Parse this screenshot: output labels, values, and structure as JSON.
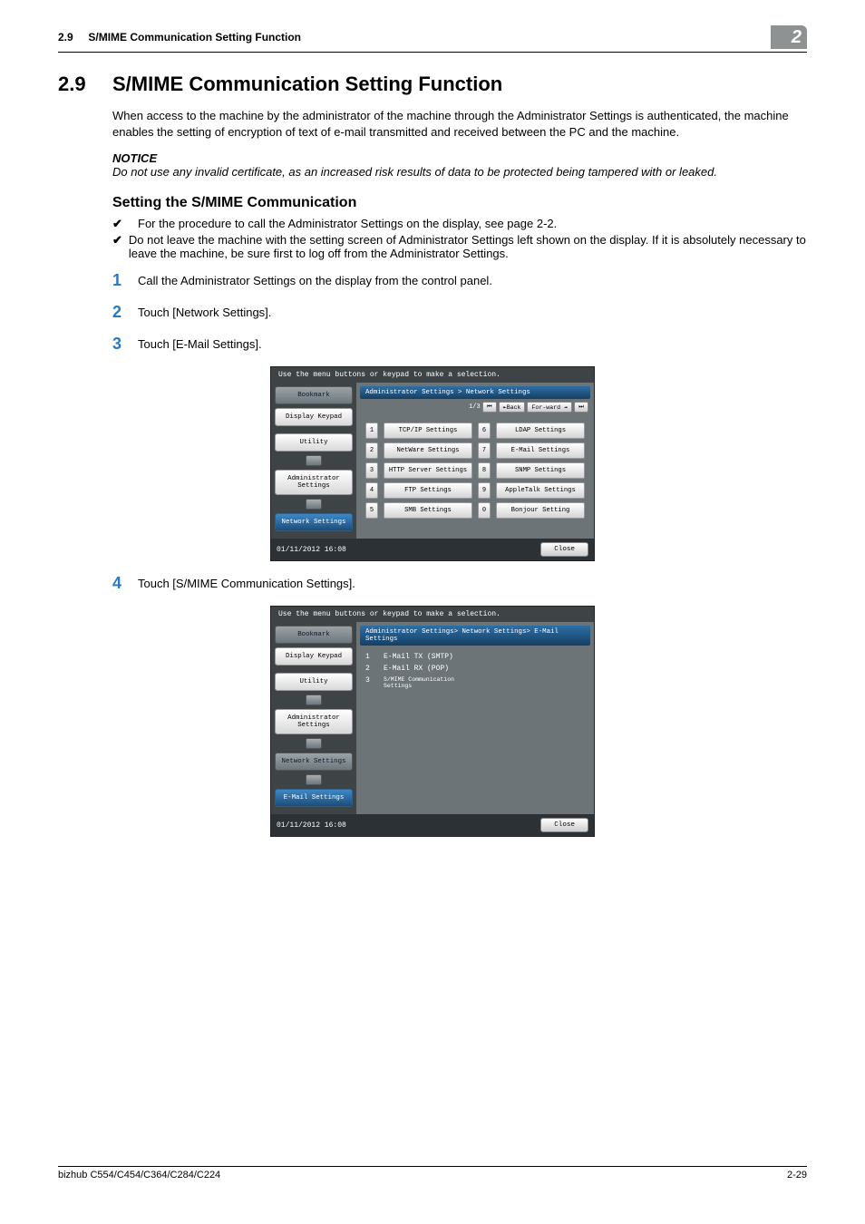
{
  "header": {
    "section_no": "2.9",
    "section_title": "S/MIME Communication Setting Function",
    "chapter_badge": "2"
  },
  "title": {
    "num": "2.9",
    "text": "S/MIME Communication Setting Function"
  },
  "intro": "When access to the machine by the administrator of the machine through the Administrator Settings is authenticated, the machine enables the setting of encryption of text of e-mail transmitted and received between the PC and the machine.",
  "notice": {
    "heading": "NOTICE",
    "body": "Do not use any invalid certificate, as an increased risk results of data to be protected being tampered with or leaked."
  },
  "subheading": "Setting the S/MIME Communication",
  "checks": [
    "For the procedure to call the Administrator Settings on the display, see page 2-2.",
    "Do not leave the machine with the setting screen of Administrator Settings left shown on the display. If it is absolutely necessary to leave the machine, be sure first to log off from the Administrator Settings."
  ],
  "steps": [
    "Call the Administrator Settings on the display from the control panel.",
    "Touch [Network Settings].",
    "Touch [E-Mail Settings].",
    "Touch [S/MIME Communication Settings]."
  ],
  "screenshot1": {
    "hint": "Use the menu buttons or keypad to make a selection.",
    "side": {
      "bookmark": "Bookmark",
      "keypad": "Display Keypad",
      "utility": "Utility",
      "admin": "Administrator Settings",
      "network": "Network Settings"
    },
    "crumb": "Administrator Settings > Network Settings",
    "pager": {
      "page": "1/3",
      "back": "↞Back",
      "fwd": "For-ward ↠"
    },
    "grid": [
      {
        "n": "1",
        "label": "TCP/IP Settings"
      },
      {
        "n": "6",
        "label": "LDAP Settings"
      },
      {
        "n": "2",
        "label": "NetWare Settings"
      },
      {
        "n": "7",
        "label": "E-Mail Settings"
      },
      {
        "n": "3",
        "label": "HTTP Server Settings"
      },
      {
        "n": "8",
        "label": "SNMP Settings"
      },
      {
        "n": "4",
        "label": "FTP Settings"
      },
      {
        "n": "9",
        "label": "AppleTalk Settings"
      },
      {
        "n": "5",
        "label": "SMB Settings"
      },
      {
        "n": "0",
        "label": "Bonjour Setting"
      }
    ],
    "datetime": "01/11/2012   16:08",
    "close": "Close"
  },
  "screenshot2": {
    "hint": "Use the menu buttons or keypad to make a selection.",
    "side": {
      "bookmark": "Bookmark",
      "keypad": "Display Keypad",
      "utility": "Utility",
      "admin": "Administrator Settings",
      "network": "Network Settings",
      "email": "E-Mail Settings"
    },
    "crumb": "Administrator Settings> Network Settings> E-Mail Settings",
    "list": [
      {
        "n": "1",
        "label": "E-Mail TX (SMTP)"
      },
      {
        "n": "2",
        "label": "E-Mail RX (POP)"
      },
      {
        "n": "3",
        "label": "S/MIME Communication Settings"
      }
    ],
    "datetime": "01/11/2012   16:08",
    "close": "Close"
  },
  "footer": {
    "left": "bizhub C554/C454/C364/C284/C224",
    "right": "2-29"
  }
}
